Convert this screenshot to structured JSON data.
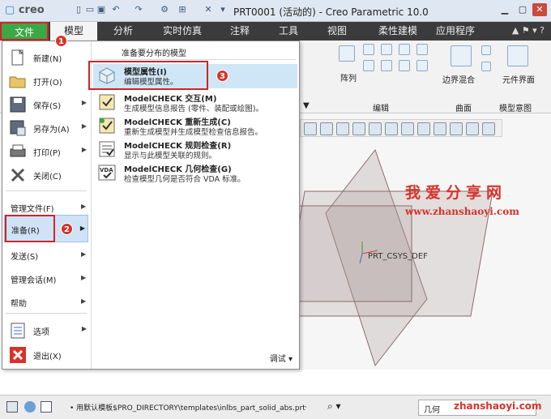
{
  "titlebar": {
    "logo": "creo",
    "title": "PRT0001 (活动的) - Creo Parametric 10.0"
  },
  "tabs": {
    "file": "文件",
    "model": "模型",
    "analysis": "分析",
    "simulation": "实时仿真",
    "annotate": "注释",
    "tools": "工具",
    "view": "视图",
    "flexible": "柔性建模",
    "apps": "应用程序"
  },
  "ribbon": {
    "array_label": "阵列",
    "edit_group": "编辑",
    "boundary_blend": "边界混合",
    "surface_group": "曲面",
    "component_interface": "元件界面",
    "model_intent_group": "模型意图"
  },
  "badges": {
    "b1": "1",
    "b2": "2",
    "b3": "3"
  },
  "file_menu": {
    "left": {
      "new": "新建(N)",
      "open": "打开(O)",
      "save": "保存(S)",
      "save_as": "另存为(A)",
      "print": "打印(P)",
      "close": "关闭(C)",
      "manage_file": "管理文件(F)",
      "prepare": "准备(R)",
      "send": "发送(S)",
      "manage_session": "管理会话(M)",
      "help": "帮助",
      "options": "选项",
      "exit": "退出(X)"
    },
    "submenu": {
      "heading": "准备要分布的模型",
      "items": [
        {
          "title": "模型属性(I)",
          "desc": "编辑模型属性。"
        },
        {
          "title": "ModelCHECK 交互(M)",
          "desc": "生成模型信息报告 (零件、装配或绘图)。"
        },
        {
          "title": "ModelCHECK 重新生成(C)",
          "desc": "重新生成模型并生成模型检查信息报告。"
        },
        {
          "title": "ModelCHECK 规则检查(R)",
          "desc": "显示与此模型关联的规则。"
        },
        {
          "title": "ModelCHECK 几何检查(G)",
          "desc": "检查模型几何是否符合 VDA 标准。"
        }
      ],
      "debug": "调试"
    }
  },
  "graphics": {
    "csys_label": "PRT_CSYS_DEF",
    "watermark_title": "我爱分享网",
    "watermark_url": "www.zhanshaoyi.com"
  },
  "statusbar": {
    "text": "• 用默认模板$PRO_DIRECTORY\\templates\\inlbs_part_solid_abs.prt作为模板",
    "filter_value": "几何",
    "watermark": "zhanshaoyi.com"
  },
  "colors": {
    "accent_green": "#39a845",
    "highlight_red": "#d1232a",
    "menu_highlight": "#cfe2f6"
  }
}
